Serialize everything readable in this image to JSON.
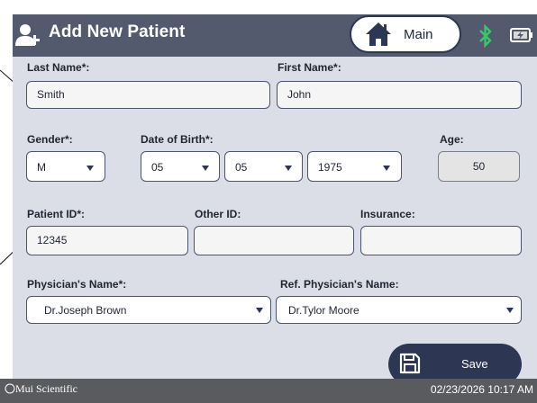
{
  "header": {
    "title": "Add New Patient",
    "main_button_label": "Main",
    "icons": [
      "add-patient-icon",
      "home-icon",
      "bluetooth-icon",
      "battery-charging-icon"
    ],
    "bluetooth_color": "#37c76b"
  },
  "form": {
    "last_name": {
      "label": "Last Name*:",
      "value": "Smith"
    },
    "first_name": {
      "label": "First Name*:",
      "value": "John"
    },
    "gender": {
      "label": "Gender*:",
      "value": "M"
    },
    "dob": {
      "label": "Date of Birth*:",
      "month": "05",
      "day": "05",
      "year": "1975"
    },
    "age": {
      "label": "Age:",
      "value": "50"
    },
    "patient_id": {
      "label": "Patient ID*:",
      "value": "12345"
    },
    "other_id": {
      "label": "Other ID:",
      "value": ""
    },
    "insurance": {
      "label": "Insurance:",
      "value": ""
    },
    "physician": {
      "label": "Physician's Name*:",
      "value": "Dr.Joseph Brown"
    },
    "ref_physician": {
      "label": "Ref. Physician's Name:",
      "value": "Dr.Tylor Moore"
    }
  },
  "save_button": {
    "label": "Save",
    "icon": "floppy-disk-icon"
  },
  "status_bar": {
    "brand": "Mui Scientific",
    "datetime": "02/23/2026 10:17 AM"
  },
  "colors": {
    "title_bar": "#535a6d",
    "form_background": "#dcdee7",
    "button_dark": "#2d3753",
    "status_bar": "#5a5b5e"
  }
}
